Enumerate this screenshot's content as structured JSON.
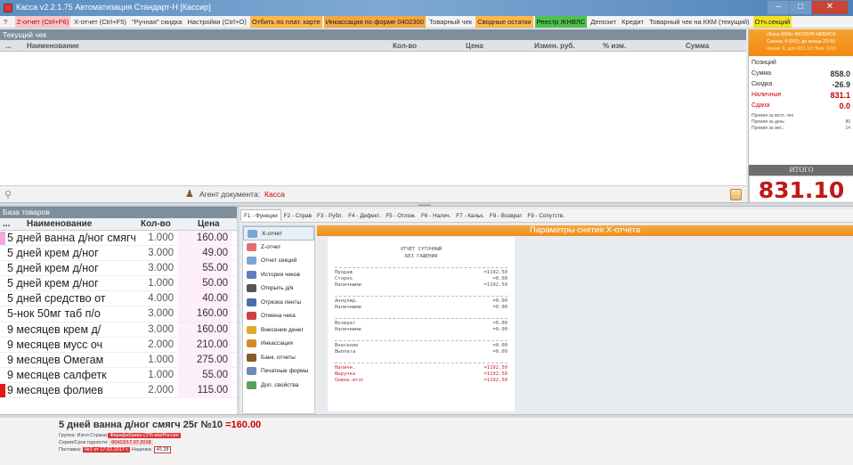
{
  "window": {
    "title": "Касса v2.2.1.75 Автоматизация Стандарт-Н [Кассир]"
  },
  "menu": {
    "help": "?",
    "items": [
      {
        "label": "Z-отчет (Ctrl+F6)",
        "style": "rb"
      },
      {
        "label": "X-отчет (Ctrl+F5)",
        "style": "pl"
      },
      {
        "label": "\"Ручная\" скидка",
        "style": "pl"
      },
      {
        "label": "Настройки (Ctrl+O)",
        "style": "pl"
      },
      {
        "label": "Отбить по плат. карте",
        "style": "or"
      },
      {
        "label": "Инкассация по форме 0402300",
        "style": "or2"
      },
      {
        "label": "Товарный чек",
        "style": "pl"
      },
      {
        "label": "Сводные остатки",
        "style": "or"
      },
      {
        "label": "Реестр ЖНВЛС",
        "style": "gr"
      },
      {
        "label": "Депозит",
        "style": "pl"
      },
      {
        "label": "Кредит",
        "style": "pl"
      },
      {
        "label": "Товарный чек на ККМ (текущий)",
        "style": "pl"
      },
      {
        "label": "Отч.секций",
        "style": "yl"
      }
    ]
  },
  "current_receipt": {
    "title": "Текущий чек",
    "columns": {
      "dots": "...",
      "name": "Наименование",
      "qty": "Кол-во",
      "price": "Цена",
      "change_rub": "Измен. руб.",
      "change_pct": "% изм.",
      "sum": "Сумма"
    },
    "agent_label": "Агент документа:",
    "agent_value": "Касса"
  },
  "right_panel": {
    "line1": "«База 60М» ФКОЗУR НЕВИСК",
    "line2": "Смена: 4 (0/0); до конца 23:59",
    "line3": "Чеков: 6; для 831.10; Внп: 0.00",
    "position_label": "Позиций",
    "sum_label": "Сумма",
    "sum_value": "858.0",
    "discount_label": "Скидка",
    "discount_value": "-26.9",
    "cash_label": "Наличные",
    "cash_value": "831.1",
    "change_label": "Сдача",
    "change_value": "0.0",
    "stats": [
      {
        "label": "Премия за восп. чек",
        "value": ""
      },
      {
        "label": "Премия за день",
        "value": "80"
      },
      {
        "label": "Премия за мес.",
        "value": "14"
      }
    ],
    "total_label": "ИТОГО",
    "total_value": "831.10"
  },
  "product_base": {
    "title": "База товаров",
    "columns": {
      "dots": "...",
      "name": "Наименование",
      "qty": "Кол-во",
      "price": "Цена"
    },
    "rows": [
      {
        "name": "5 дней ванна д/ног смягч 25г №10",
        "qty": "1.000",
        "price": "160.00",
        "marker": "#f3a9dd"
      },
      {
        "name": "5 дней крем д/ног",
        "qty": "3.000",
        "price": "49.00",
        "marker": ""
      },
      {
        "name": "5 дней крем д/ног",
        "qty": "3.000",
        "price": "55.00",
        "marker": ""
      },
      {
        "name": "5 дней крем д/ног",
        "qty": "1.000",
        "price": "50.00",
        "marker": ""
      },
      {
        "name": "5 дней средство от",
        "qty": "4.000",
        "price": "40.00",
        "marker": ""
      },
      {
        "name": "5-нок 50мг таб п/о",
        "qty": "3.000",
        "price": "160.00",
        "marker": ""
      },
      {
        "name": "9 месяцев крем д/",
        "qty": "3.000",
        "price": "160.00",
        "marker": ""
      },
      {
        "name": "9 месяцев мусс оч",
        "qty": "2.000",
        "price": "210.00",
        "marker": ""
      },
      {
        "name": "9 месяцев Омегам",
        "qty": "1.000",
        "price": "275.00",
        "marker": ""
      },
      {
        "name": "9 месяцев салфетк",
        "qty": "1.000",
        "price": "55.00",
        "marker": ""
      },
      {
        "name": "9 месяцев фолиев",
        "qty": "2.000",
        "price": "115.00",
        "marker": "#e01818"
      }
    ]
  },
  "function_tabs": [
    "F1 - Функции",
    "F2 - Справ",
    "F3 - Рубл.",
    "F4 - Дефект.",
    "F5 - Отлож.",
    "F6 - Налич.",
    "F7 - Кальк.",
    "F8 - Возврат",
    "F9 - Сопутств."
  ],
  "function_menu": [
    {
      "label": "X-отчет",
      "icon": "report-icon",
      "color": "#7aa6d6",
      "active": true
    },
    {
      "label": "Z-отчет",
      "icon": "report-icon",
      "color": "#e07070",
      "active": false
    },
    {
      "label": "Отчет секций",
      "icon": "report-icon",
      "color": "#7aa6d6",
      "active": false
    },
    {
      "label": "История чеков",
      "icon": "history-icon",
      "color": "#5a7fc0",
      "active": false
    },
    {
      "label": "Открыть д/я",
      "icon": "drawer-icon",
      "color": "#555555",
      "active": false
    },
    {
      "label": "Отрезка ленты",
      "icon": "scissors-icon",
      "color": "#4a6fa8",
      "active": false
    },
    {
      "label": "Отмена чека",
      "icon": "cancel-icon",
      "color": "#d04040",
      "active": false
    },
    {
      "label": "Внесение денег",
      "icon": "money-icon",
      "color": "#e5a830",
      "active": false
    },
    {
      "label": "Инкассация",
      "icon": "bag-icon",
      "color": "#d68a2a",
      "active": false
    },
    {
      "label": "Банк. отчеты",
      "icon": "bank-icon",
      "color": "#8a5a2a",
      "active": false
    },
    {
      "label": "Печатные формы",
      "icon": "print-icon",
      "color": "#6a8ab8",
      "active": false
    },
    {
      "label": "Доп. свойства",
      "icon": "gear-icon",
      "color": "#5aa05a",
      "active": false
    }
  ],
  "x_report": {
    "title": "Параметры снятия X-отчета",
    "header1": "ОТЧЕТ СУТОЧНЫЙ",
    "header2": "БЕЗ ГАШЕНИЯ",
    "groups": [
      [
        {
          "label": "Продаж",
          "value": "=1192.50",
          "red": false
        },
        {
          "label": "Сторно",
          "value": "=0.00",
          "red": false
        },
        {
          "label": "Наличными",
          "value": "=1192.50",
          "red": false
        }
      ],
      [
        {
          "label": "Аннулир.",
          "value": "=0.00",
          "red": false
        },
        {
          "label": "Наличными",
          "value": "=0.00",
          "red": false
        }
      ],
      [
        {
          "label": "Возврат",
          "value": "=0.00",
          "red": false
        },
        {
          "label": "Наличными",
          "value": "=0.00",
          "red": false
        }
      ],
      [
        {
          "label": "Внесение",
          "value": "=0.00",
          "red": false
        },
        {
          "label": "Выплата",
          "value": "=0.00",
          "red": false
        }
      ],
      [
        {
          "label": "Наличн.",
          "value": "=1192.50",
          "red": true
        },
        {
          "label": "Выручка",
          "value": "=1192.50",
          "red": true
        },
        {
          "label": "Сменн.итог",
          "value": "=1192.50",
          "red": true
        }
      ]
    ]
  },
  "product_info": {
    "name": "5 дней ванна д/ног смягч 25г №10",
    "price": "=160.00",
    "group_label": "Группа:",
    "group_value": "Изгот.Страна",
    "group_tag": "Фарафабрика СПб мм/Россия",
    "serial_label": "Серия/Срок годности:",
    "serial_value": "60413/17.07.2018",
    "supply_label": "Поставка:",
    "supply_value": "№1 от 17.02.2017 г.",
    "markup_label": "Наценка:",
    "markup_value": "45.38"
  }
}
